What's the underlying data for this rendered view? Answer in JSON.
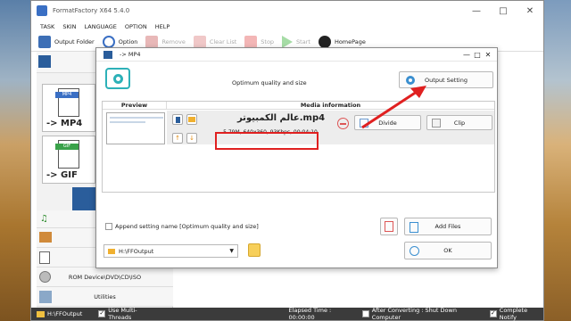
{
  "app": {
    "title": "FormatFactory X64 5.4.0"
  },
  "menu": [
    "TASK",
    "SKIN",
    "LANGUAGE",
    "OPTION",
    "HELP"
  ],
  "toolbar": {
    "output_folder": "Output Folder",
    "option": "Option",
    "remove": "Remove",
    "clear_list": "Clear List",
    "stop": "Stop",
    "start": "Start",
    "homepage": "HomePage"
  },
  "sidebar": {
    "mp4_label": "-> MP4",
    "gif_label": "-> GIF",
    "rom": "ROM Device\\DVD\\CD\\ISO",
    "utilities": "Utilities"
  },
  "dialog": {
    "title": "-> MP4",
    "quality": "Optimum quality and size",
    "output_setting": "Output Setting",
    "col_preview": "Preview",
    "col_media": "Media information",
    "file_name": "عالم الكمبيوتر.mp4",
    "file_info": "5.79M, 640x360, 93Kbps, 00:04:10",
    "divide": "Divide",
    "clip": "Clip",
    "append_setting": "Append setting name [Optimum quality and size]",
    "add_files": "Add Files",
    "output_path": "H:\\FFOutput",
    "ok": "OK"
  },
  "status": {
    "path": "H:\\FFOutput",
    "multi_threads": "Use Multi-Threads",
    "elapsed": "Elapsed Time : 00:00:00",
    "after_converting": "After Converting : Shut Down Computer",
    "complete_notify": "Complete Notify"
  },
  "colors": {
    "accent": "#2f8fd0",
    "annotation": "#e02020",
    "statusbar": "#3b3b3b"
  }
}
